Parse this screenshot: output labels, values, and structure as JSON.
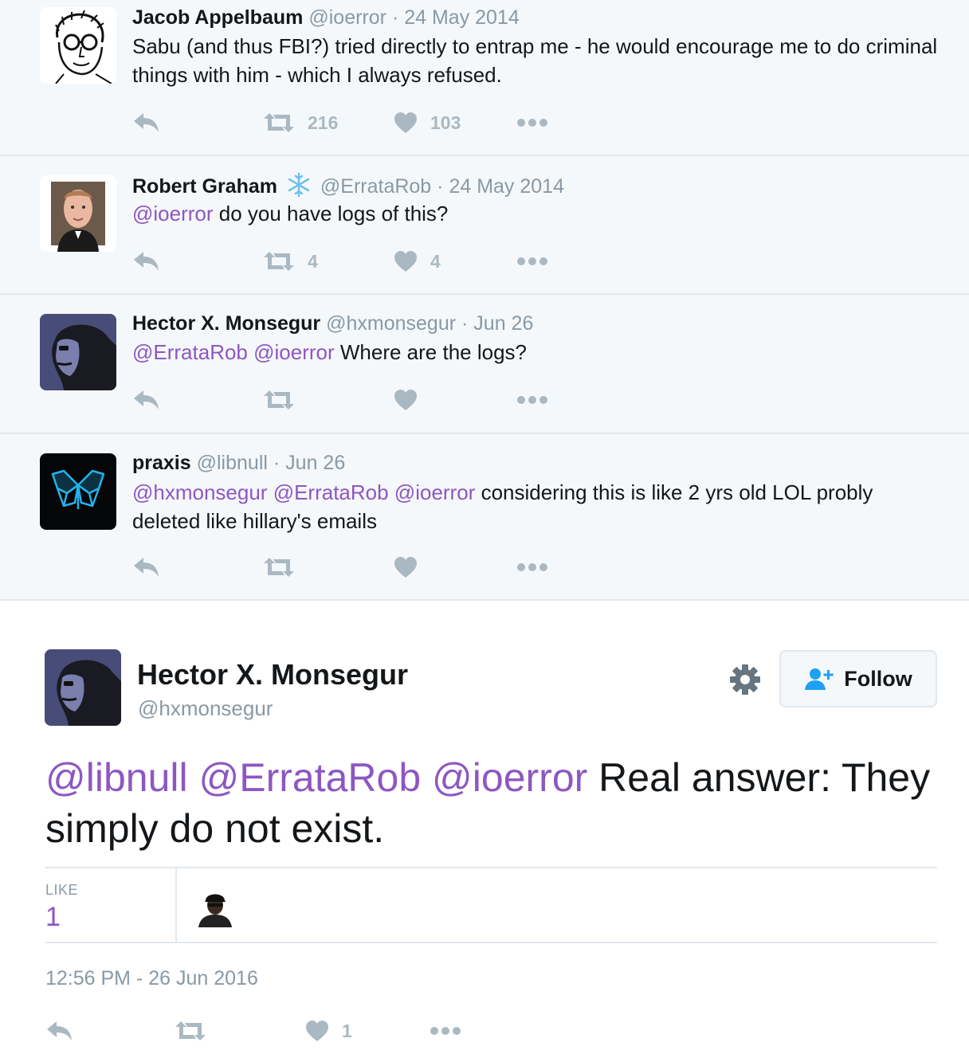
{
  "thread": [
    {
      "name": "Jacob Appelbaum",
      "handle": "@ioerror",
      "date": "· 24 May 2014",
      "text_parts": [
        "Sabu (and thus FBI?) tried directly to entrap me - he would encourage me to do criminal things with him - which I always refused."
      ],
      "retweets": "216",
      "likes": "103"
    },
    {
      "name": "Robert Graham",
      "badge": "snowflake-icon",
      "handle": "@ErrataRob",
      "date": "· 24 May 2014",
      "mentions": "@ioerror",
      "text": " do you have logs of this?",
      "retweets": "4",
      "likes": "4"
    },
    {
      "name": "Hector X. Monsegur",
      "handle": "@hxmonsegur",
      "date": "· Jun 26",
      "mentions": "@ErrataRob @ioerror",
      "text": " Where are the logs?"
    },
    {
      "name": "praxis",
      "handle": "@libnull",
      "date": "· Jun 26",
      "mentions": "@hxmonsegur @ErrataRob @ioerror",
      "text": " considering this is like 2 yrs old LOL probly deleted like hillary's emails"
    }
  ],
  "main": {
    "name": "Hector X. Monsegur",
    "handle": "@hxmonsegur",
    "follow_label": "Follow",
    "mentions": "@libnull @ErrataRob @ioerror",
    "text": " Real answer: They simply do not exist.",
    "like_label": "LIKE",
    "like_count": "1",
    "timestamp": "12:56 PM - 26 Jun 2016",
    "likes": "1"
  },
  "colors": {
    "mention": "#8d57c2",
    "muted": "#8899a6",
    "icon": "#aab8c2",
    "thread_bg": "#f5f8fa",
    "divider": "#e1e8ed"
  }
}
